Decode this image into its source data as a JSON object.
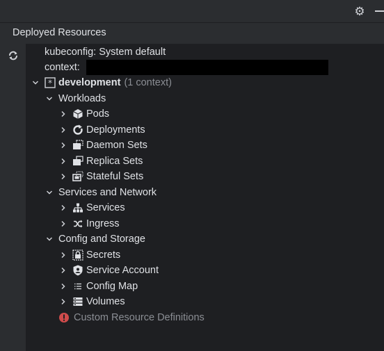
{
  "header": {
    "title": "Deployed Resources"
  },
  "tree": {
    "kubeconfig": "kubeconfig: System default",
    "context_label": "context:",
    "cluster": {
      "name": "development",
      "count": "(1 context)"
    },
    "workloads": {
      "label": "Workloads",
      "items": [
        "Pods",
        "Deployments",
        "Daemon Sets",
        "Replica Sets",
        "Stateful Sets"
      ]
    },
    "network": {
      "label": "Services and Network",
      "items": [
        "Services",
        "Ingress"
      ]
    },
    "config": {
      "label": "Config and Storage",
      "items": [
        "Secrets",
        "Service Account",
        "Config Map",
        "Volumes"
      ]
    },
    "crd": {
      "label": "Custom Resource Definitions",
      "color": "#cf4b4b"
    }
  },
  "icons": {
    "toolbar": [
      "gear-icon",
      "minimize-icon",
      "refresh-icon"
    ]
  }
}
